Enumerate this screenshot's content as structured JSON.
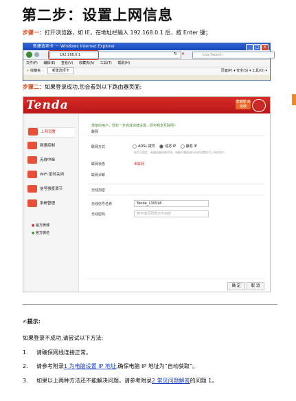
{
  "heading": "第二步：设置上网信息",
  "step1": {
    "label": "步骤一：",
    "text": "打开浏览器，如 IE，在地址栏输入 192.168.0.1 后，按 Enter 键；"
  },
  "browser": {
    "window_title": "新建选项卡 － Windows Internet Explorer",
    "address": "192.168.0.1",
    "search_placeholder": "Live Search",
    "menus": [
      "文件(F)",
      "编辑(E)",
      "查看(V)",
      "收藏夹(A)",
      "工具(T)",
      "帮助(H)"
    ],
    "favorites_label": "收藏夹",
    "tab_label": "新建选项卡",
    "toolbar_items": "页面(P) ▾  安全(S) ▾  工具(O) ▾"
  },
  "step2": {
    "label": "步骤二：",
    "text": "如果登录成功,您会看到以下路由器页面:"
  },
  "router": {
    "logo": "Tenda",
    "badge_primary": "增值版 高级版",
    "nav": [
      {
        "label": "上网设置",
        "active": true,
        "color": "#e8503a"
      },
      {
        "label": "网速控制",
        "active": false,
        "color": "#e8503a"
      },
      {
        "label": "无线中继",
        "active": false,
        "color": "#e8503a"
      },
      {
        "label": "WiFi 定时关闭",
        "active": false,
        "color": "#e8503a"
      },
      {
        "label": "信号强度调节",
        "active": false,
        "color": "#e8503a"
      },
      {
        "label": "系统管理",
        "active": false,
        "color": "#e8503a"
      }
    ],
    "social": [
      "官方微博",
      "官方微信"
    ],
    "welcome": "尊敬的用户，轻松一步完成快捷设置，即可畅享互联网~",
    "section_net": "联网",
    "mode_label": "联网方式",
    "modes": [
      "ADSL 拨号",
      "动态 IP",
      "静态 IP"
    ],
    "mode_hint": "适用于固定、有路由器网络环境，电脑不需要进行任何设置即可上网的用户",
    "status_label": "联网状态",
    "status_value": "未联网",
    "diag_label": "联网诊断",
    "section_wifi": "无线加密",
    "ssid_label": "无线信号名称",
    "ssid_value": "Tenda_130518",
    "pwd_label": "无线密码",
    "pwd_placeholder": "若不填写则表示不加密",
    "ok_button": "确 定",
    "cancel_button": "取 消"
  },
  "tips_title": "提示:",
  "intro": "如果登录不成功,请尝试以下方法:",
  "items": [
    {
      "num": "1.",
      "text": "请确保网线连接正常。"
    },
    {
      "num": "2.",
      "pre": "请参考附录",
      "link": "1 为电脑设置 IP 地址",
      "post": ",确保电脑 IP 地址为“自动获取”。"
    },
    {
      "num": "3.",
      "pre": "如果以上两种方法还不能解决问题，请参考附录",
      "link": "2 常见问题解答",
      "post": "的问题 1。"
    }
  ]
}
